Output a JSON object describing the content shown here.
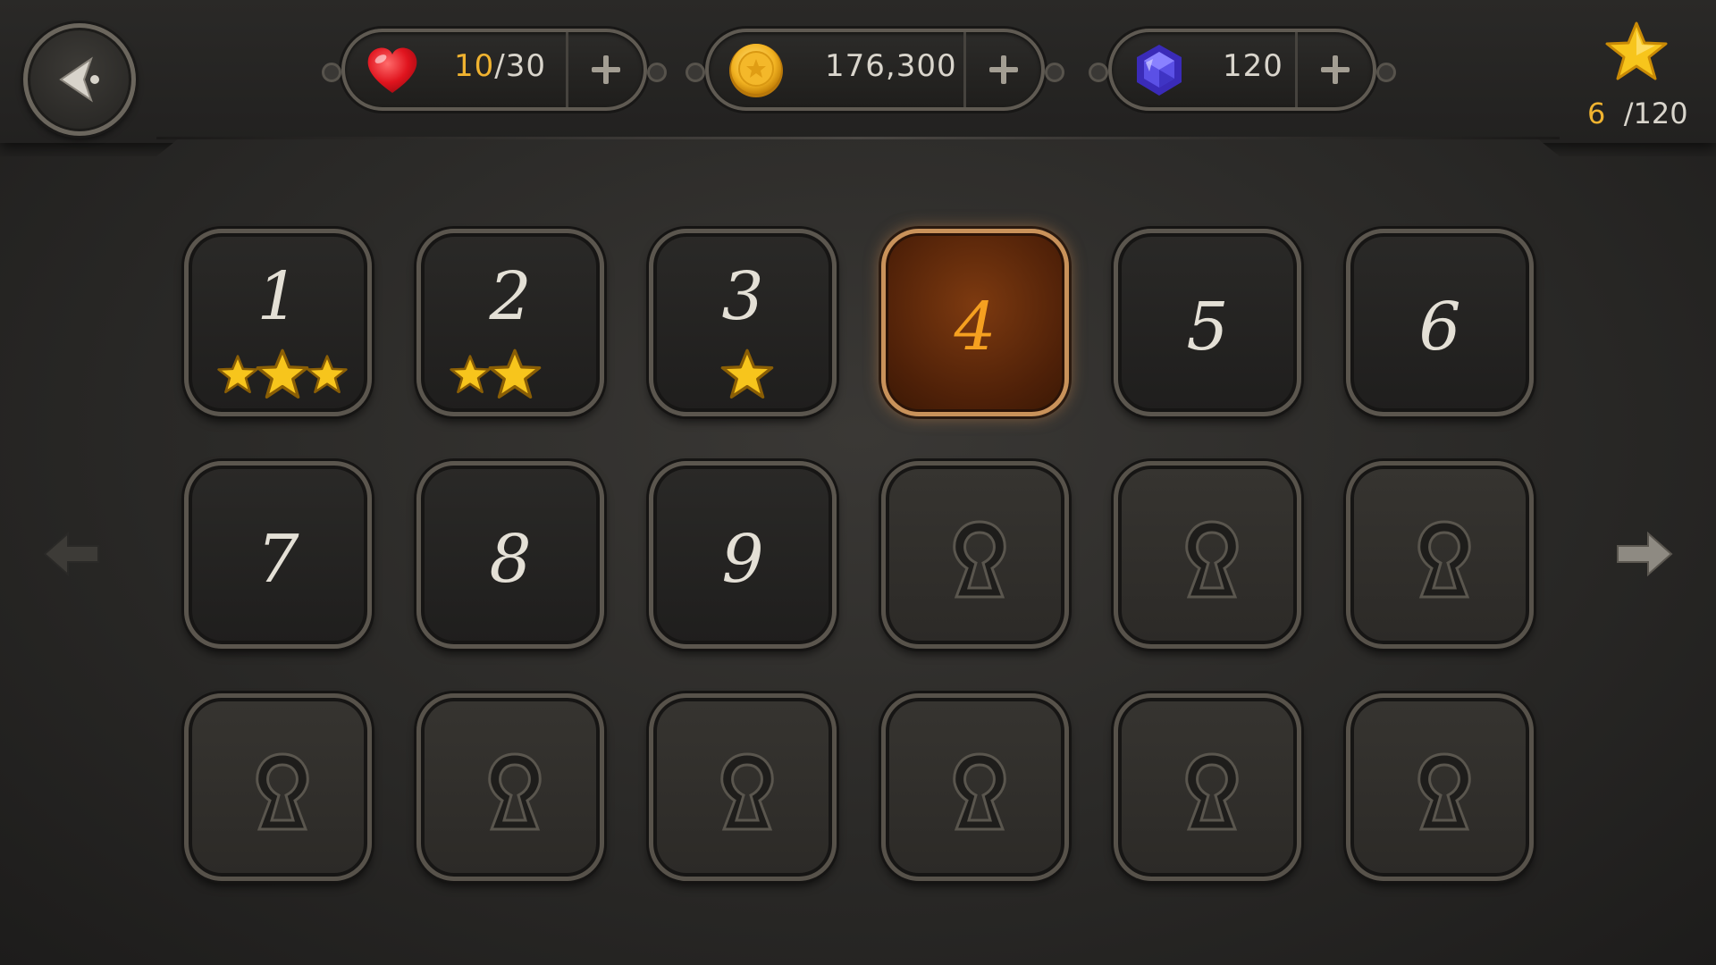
{
  "hud": {
    "lives": {
      "current": "10",
      "max": "/30"
    },
    "coins": {
      "value": "176,300"
    },
    "gems": {
      "value": "120"
    },
    "stars": {
      "current": "6",
      "max": "/120"
    }
  },
  "levels": [
    {
      "number": "1",
      "state": "completed",
      "stars": 3
    },
    {
      "number": "2",
      "state": "completed",
      "stars": 2
    },
    {
      "number": "3",
      "state": "completed",
      "stars": 1
    },
    {
      "number": "4",
      "state": "current",
      "stars": 0
    },
    {
      "number": "5",
      "state": "unlocked",
      "stars": 0
    },
    {
      "number": "6",
      "state": "unlocked",
      "stars": 0
    },
    {
      "number": "7",
      "state": "unlocked",
      "stars": 0
    },
    {
      "number": "8",
      "state": "unlocked",
      "stars": 0
    },
    {
      "number": "9",
      "state": "unlocked",
      "stars": 0
    },
    {
      "number": "",
      "state": "locked",
      "stars": 0
    },
    {
      "number": "",
      "state": "locked",
      "stars": 0
    },
    {
      "number": "",
      "state": "locked",
      "stars": 0
    },
    {
      "number": "",
      "state": "locked",
      "stars": 0
    },
    {
      "number": "",
      "state": "locked",
      "stars": 0
    },
    {
      "number": "",
      "state": "locked",
      "stars": 0
    },
    {
      "number": "",
      "state": "locked",
      "stars": 0
    },
    {
      "number": "",
      "state": "locked",
      "stars": 0
    },
    {
      "number": "",
      "state": "locked",
      "stars": 0
    }
  ],
  "icons": {
    "back": "back-arrow-icon",
    "lives": "heart-icon",
    "coins": "coin-icon",
    "gems": "gem-icon",
    "add": "plus-icon",
    "stars": "star-icon",
    "locked": "keyhole-lock-icon",
    "prev": "left-arrow-icon",
    "next": "right-arrow-icon"
  },
  "colors": {
    "accent_gold": "#f0b330",
    "current_level_text": "#f5a020",
    "text_light": "#e4e0d6"
  }
}
